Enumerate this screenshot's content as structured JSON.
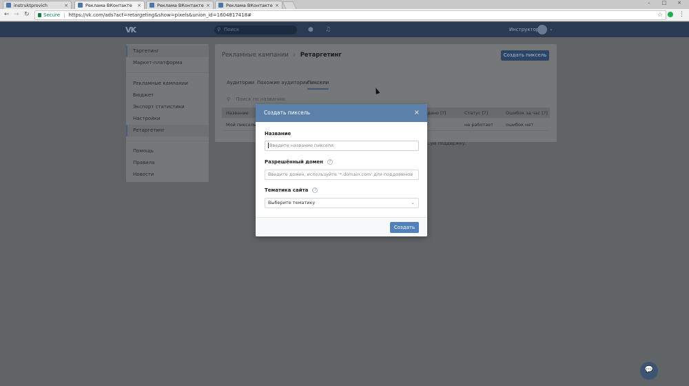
{
  "browser": {
    "tabs": [
      {
        "title": "instruktprovich",
        "close": "×"
      },
      {
        "title": "Реклама ВКонтакте",
        "close": "×"
      },
      {
        "title": "Реклама ВКонтакте",
        "close": "×"
      },
      {
        "title": "Реклама ВКонтакте",
        "close": "×"
      }
    ],
    "secure_label": "Secure",
    "url": "https://vk.com/ads?act=retargeting&show=pixels&union_id=1604817418#",
    "window_controls": [
      "–",
      "□",
      "×"
    ]
  },
  "vk_header": {
    "logo": "VK",
    "search_placeholder": "Поиск",
    "user_name": "Инструктор"
  },
  "sidebar": {
    "group1": [
      "Таргетинг",
      "Маркет-платформа"
    ],
    "group2": [
      "Рекламные кампании",
      "Бюджет",
      "Экспорт статистики",
      "Настройки",
      "Ретаргетинг"
    ],
    "group3": [
      "Помощь",
      "Правила",
      "Новости"
    ]
  },
  "main": {
    "breadcrumb_parent": "Рекламные кампании",
    "breadcrumb_sep": "›",
    "breadcrumb_current": "Ретаргетинг",
    "create_pixel_button": "Создать пиксель",
    "tabs": [
      "Аудитории",
      "Похожие аудитории",
      "Пиксели"
    ],
    "search_placeholder": "Поиск по названию",
    "table": {
      "headers": [
        "Название",
        "...дано [?]",
        "Статус [?]",
        "Ошибок за час [?]"
      ],
      "row": {
        "name": "Мой пиксель",
        "status": "не работает",
        "errors": "ошибок нет"
      }
    },
    "support_text": "...ую поддержку."
  },
  "modal": {
    "title": "Создать пиксель",
    "close": "×",
    "name_label": "Название",
    "name_placeholder": "Введите название пикселя",
    "domain_label": "Разрешённый домен",
    "domain_placeholder": "Введите домен, используйте '*.domain.com' для поддоменов",
    "theme_label": "Тематика сайта",
    "theme_value": "Выберите тематику",
    "submit_button": "Создать",
    "help_glyph": "?"
  },
  "colors": {
    "vk_header": "#2a3a52",
    "modal_header": "#5b81ab",
    "primary_button": "#5181b8",
    "overlay": "#616466"
  }
}
